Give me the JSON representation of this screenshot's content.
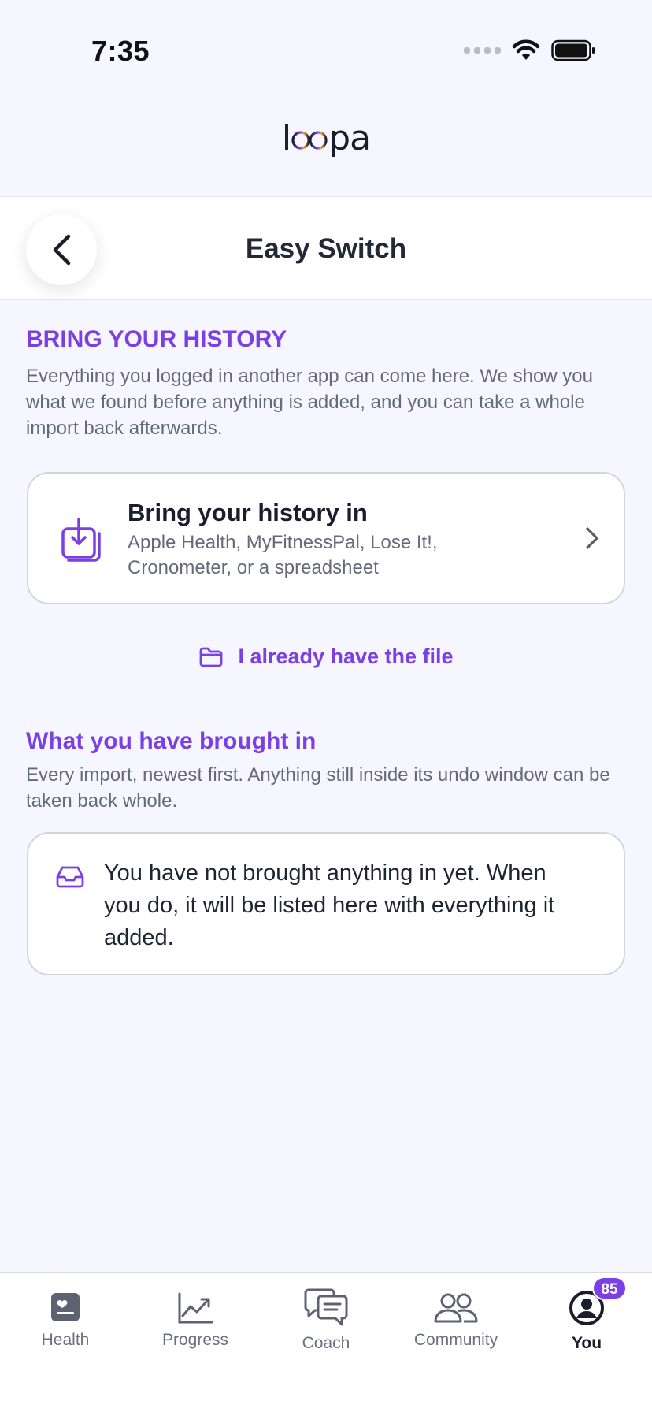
{
  "status_bar": {
    "time": "7:35"
  },
  "brand": {
    "logo_text_left": "l",
    "logo_text_mid": "oo",
    "logo_text_right": "pa"
  },
  "nav": {
    "title": "Easy Switch"
  },
  "history_section": {
    "heading": "BRING YOUR HISTORY",
    "description": "Everything you logged in another app can come here. We show you what we found before anything is added, and you can take a whole import back afterwards."
  },
  "import_card": {
    "title": "Bring your history in",
    "subtitle": "Apple Health, MyFitnessPal, Lose It!, Cronometer, or a spreadsheet"
  },
  "file_link": {
    "label": "I already have the file"
  },
  "brought_section": {
    "heading": "What you have brought in",
    "description": "Every import, newest first. Anything still inside its undo window can be taken back whole."
  },
  "empty_state": {
    "text": "You have not brought anything in yet. When you do, it will be listed here with everything it added."
  },
  "tabs": [
    {
      "label": "Health",
      "icon": "health-icon"
    },
    {
      "label": "Progress",
      "icon": "chart-icon"
    },
    {
      "label": "Coach",
      "icon": "chat-icon"
    },
    {
      "label": "Community",
      "icon": "people-icon"
    },
    {
      "label": "You",
      "icon": "user-icon",
      "active": true
    }
  ],
  "you_badge": "85",
  "colors": {
    "accent": "#7b3fe4",
    "background": "#f5f6ff",
    "text": "#1f2433",
    "muted": "#656a7a"
  }
}
